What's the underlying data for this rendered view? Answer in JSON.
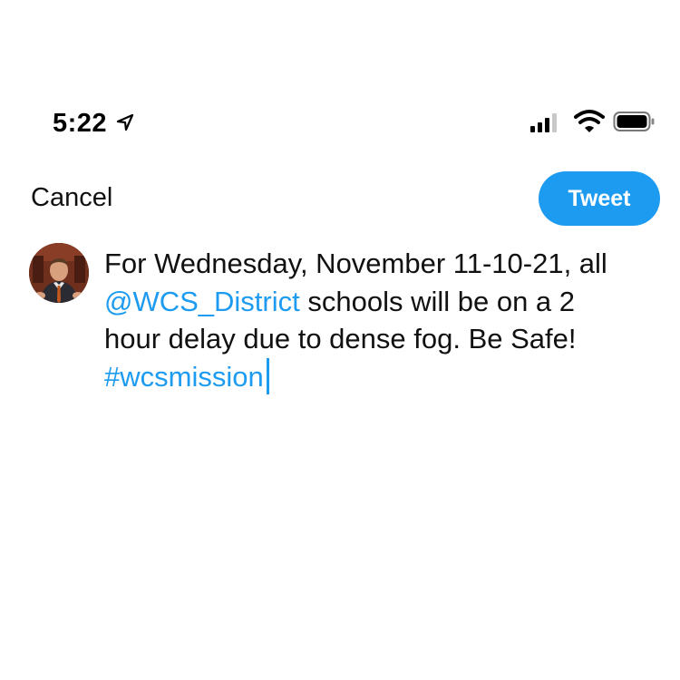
{
  "status_bar": {
    "time": "5:22",
    "icons": [
      "location-arrow-icon",
      "cellular-signal-icon",
      "wifi-icon",
      "battery-icon"
    ]
  },
  "header": {
    "cancel_label": "Cancel",
    "tweet_label": "Tweet"
  },
  "composer": {
    "avatar_icon": "profile-avatar",
    "line1": "For Wednesday, November 11-10-21, all",
    "line2_mention": "@WCS_District",
    "line2_rest": " schools will be on a 2",
    "line3": "hour delay due to dense fog. Be Safe!",
    "line4_hashtag": "#wcsmission"
  },
  "colors": {
    "accent": "#1d9bf0",
    "text": "#111111",
    "background": "#ffffff"
  }
}
